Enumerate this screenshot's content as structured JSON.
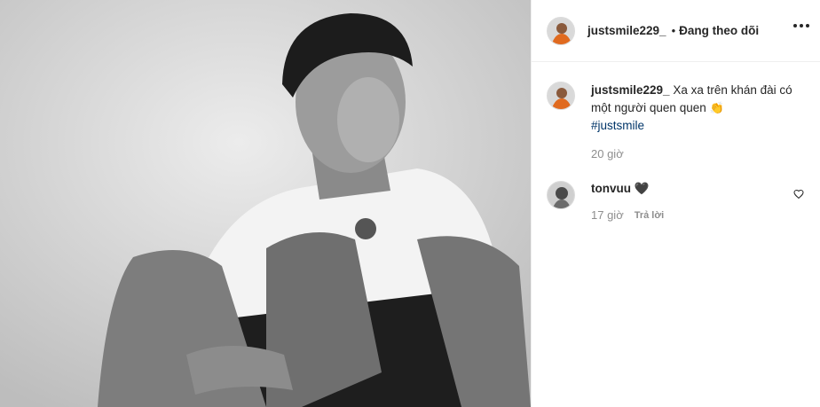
{
  "post": {
    "author": "justsmile229_",
    "separator": "•",
    "follow_status": "Đang theo dõi",
    "caption_text": "Xa xa trên khán đài có một người quen quen",
    "caption_emoji": "👏",
    "hashtag": "#justsmile",
    "timestamp": "20 giờ"
  },
  "comments": [
    {
      "username": "tonvuu",
      "text": "🖤",
      "time": "17 giờ",
      "reply_label": "Trả lời"
    }
  ],
  "icons": {
    "more": "more-options-icon",
    "like": "heart-outline-icon"
  },
  "colors": {
    "hashtag": "#003569",
    "muted": "#8e8e8e",
    "text": "#262626",
    "border": "#efefef"
  }
}
